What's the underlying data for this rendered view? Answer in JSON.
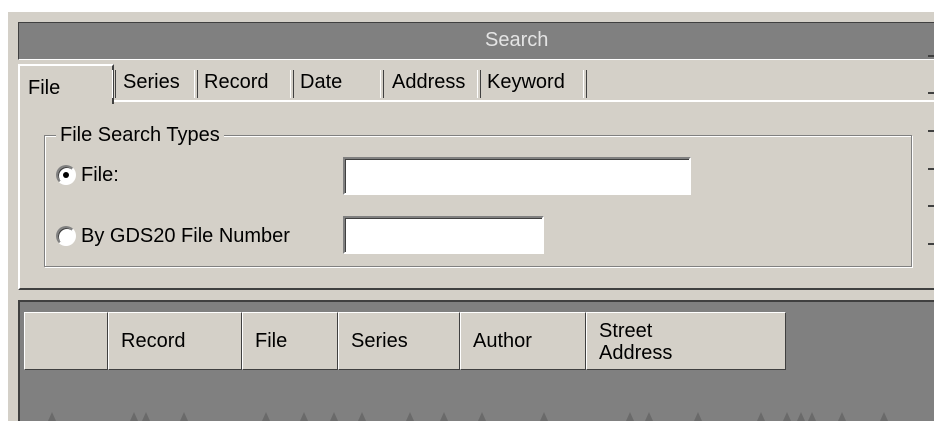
{
  "window": {
    "title": "Search"
  },
  "tabs": [
    {
      "label": "File",
      "active": true
    },
    {
      "label": "Series",
      "active": false
    },
    {
      "label": "Record",
      "active": false
    },
    {
      "label": "Date",
      "active": false
    },
    {
      "label": "Address",
      "active": false
    },
    {
      "label": "Keyword",
      "active": false
    }
  ],
  "file_search": {
    "group_label": "File Search Types",
    "options": [
      {
        "label": "File:",
        "checked": true,
        "input_value": ""
      },
      {
        "label": "By GDS20 File Number",
        "checked": false,
        "input_value": ""
      }
    ]
  },
  "results_grid": {
    "columns": [
      "",
      "Record",
      "File",
      "Series",
      "Author",
      "Street\nAddress"
    ],
    "street_lines": [
      "Street",
      "Address"
    ],
    "rows": []
  },
  "colors": {
    "face": "#d4d0c8",
    "dark_gray": "#808080",
    "title_text": "#e4e4e4"
  }
}
